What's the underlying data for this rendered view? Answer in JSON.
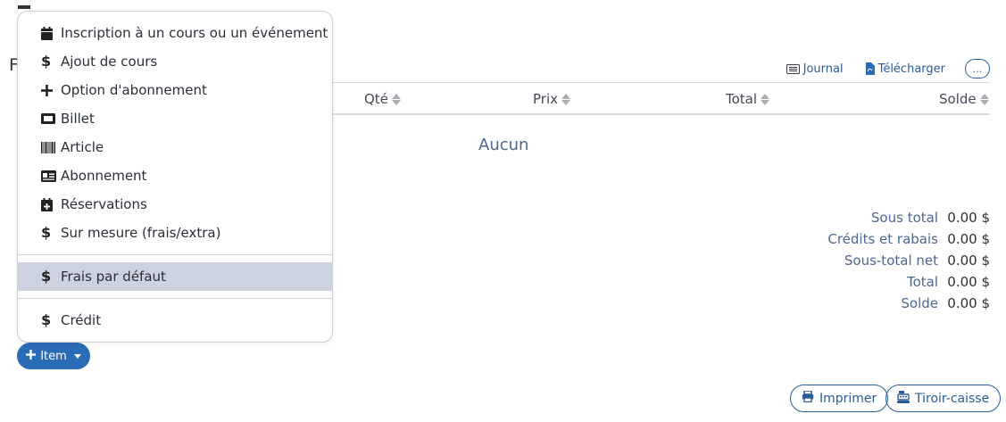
{
  "menu": {
    "items": [
      {
        "label": "Inscription à un cours ou un événement",
        "icon": "calendar-icon"
      },
      {
        "label": "Ajout de cours",
        "icon": "dollar-icon"
      },
      {
        "label": "Option d'abonnement",
        "icon": "plus-icon"
      },
      {
        "label": "Billet",
        "icon": "ticket-icon"
      },
      {
        "label": "Article",
        "icon": "barcode-icon"
      },
      {
        "label": "Abonnement",
        "icon": "id-card-icon"
      },
      {
        "label": "Réservations",
        "icon": "calendar-plus-icon"
      },
      {
        "label": "Sur mesure (frais/extra)",
        "icon": "dollar-icon"
      },
      {
        "label": "Frais par défaut",
        "icon": "dollar-icon",
        "highlighted": true
      },
      {
        "label": "Crédit",
        "icon": "dollar-icon"
      }
    ]
  },
  "header_letter": "F",
  "doc_actions": {
    "journal": "Journal",
    "download": "Télécharger",
    "more": "..."
  },
  "table": {
    "columns": [
      "Qté",
      "Prix",
      "Total",
      "Solde"
    ],
    "empty_text": "Aucun"
  },
  "totals": [
    {
      "label": "Sous total",
      "value": "0.00 $"
    },
    {
      "label": "Crédits et rabais",
      "value": "0.00 $"
    },
    {
      "label": "Sous-total net",
      "value": "0.00 $"
    },
    {
      "label": "Total",
      "value": "0.00 $"
    },
    {
      "label": "Solde",
      "value": "0.00 $"
    }
  ],
  "item_button": "Item",
  "footer_buttons": {
    "print": "Imprimer",
    "drawer": "Tiroir-caisse"
  },
  "colors": {
    "accent": "#2a6cb5",
    "link": "#2a5c98",
    "menu_highlight": "#ccd2de",
    "muted_text": "#4d6790"
  }
}
